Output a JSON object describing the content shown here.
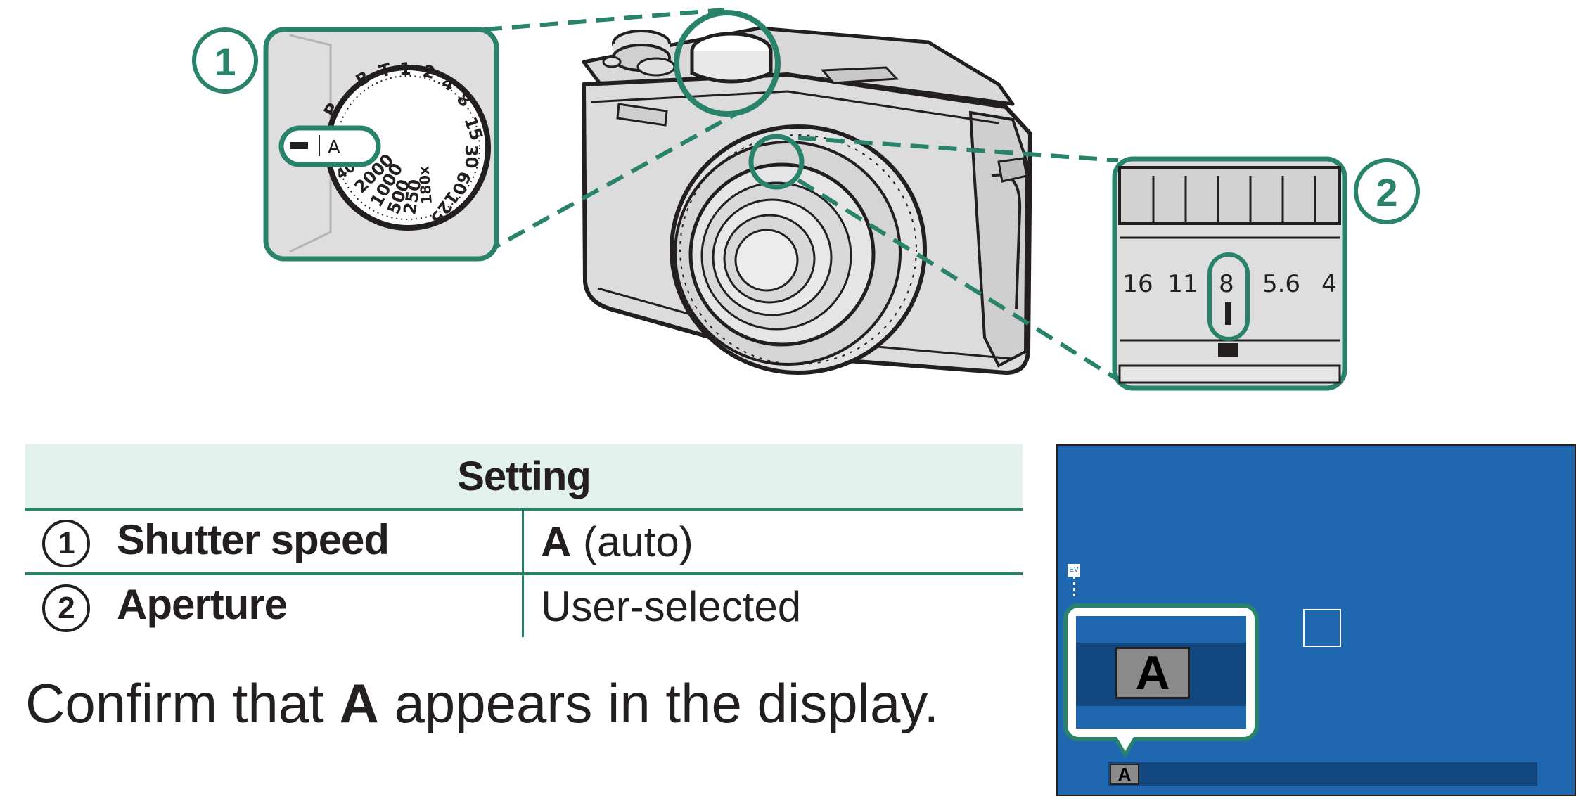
{
  "illustration": {
    "callout_1_number": "1",
    "callout_2_number": "2",
    "shutter_dial": {
      "selected_label": "A",
      "marks": [
        "P",
        "B",
        "T",
        "1",
        "2",
        "4",
        "8",
        "15",
        "30",
        "60",
        "125",
        "180x",
        "250",
        "500",
        "1000",
        "2000",
        "400"
      ]
    },
    "aperture_ring": {
      "values": [
        "16",
        "11",
        "8",
        "5.6",
        "4"
      ],
      "selected_value": "8"
    }
  },
  "table": {
    "header": "Setting",
    "rows": [
      {
        "number": "1",
        "name": "Shutter speed",
        "value_bold": "A",
        "value_rest": " (auto)"
      },
      {
        "number": "2",
        "name": "Aperture",
        "value_bold": "",
        "value_rest": "User-selected"
      }
    ]
  },
  "instruction": {
    "before": "Confirm that ",
    "highlight": "A",
    "after": " appears in the display."
  },
  "lcd": {
    "mode_large": "A",
    "mode_small": "A",
    "ev_label": "EV"
  },
  "colors": {
    "accent_green": "#28836a",
    "header_bg": "#e3f1ec",
    "lcd_blue": "#1f68b0",
    "lcd_dark_band": "#12477f"
  }
}
